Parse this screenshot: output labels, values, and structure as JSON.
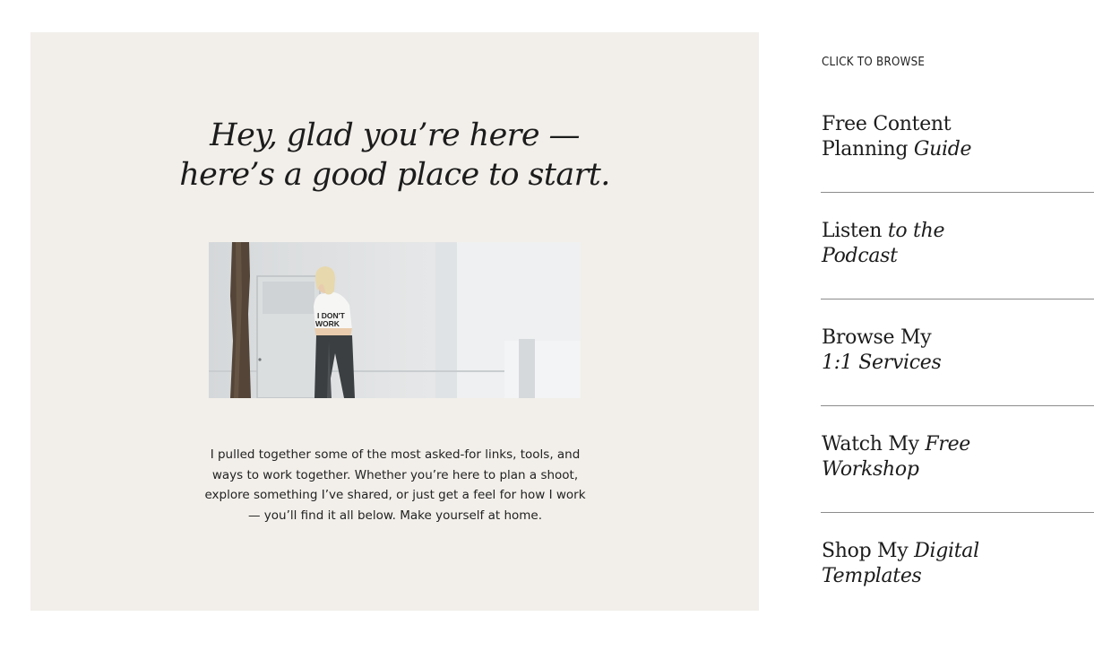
{
  "hero": {
    "title_line1": "Hey, glad you’re here —",
    "title_line2": "here’s a good place to start.",
    "photo_alt": "Woman in a white T-shirt leaning against a white wall beside a tree",
    "photo_shirt_text_line1": "I DON'T",
    "photo_shirt_text_line2": "WORK",
    "body": "I pulled together some of the most asked-for links, tools, and ways to work together. Whether you’re here to plan a shoot, explore something I’ve shared, or just get a feel for how I work — you’ll find it all below. Make yourself at home."
  },
  "browse": {
    "label": "CLICK TO BROWSE",
    "items": [
      {
        "line1_plain": "Free Content",
        "line1_italic": "",
        "line2_plain": "Planning ",
        "line2_italic": "Guide"
      },
      {
        "line1_plain": "Listen ",
        "line1_italic": "to the",
        "line2_plain": "",
        "line2_italic": "Podcast"
      },
      {
        "line1_plain": "Browse My",
        "line1_italic": "",
        "line2_plain": "",
        "line2_italic": "1:1 Services"
      },
      {
        "line1_plain": "Watch My ",
        "line1_italic": "Free",
        "line2_plain": "",
        "line2_italic": "Workshop"
      },
      {
        "line1_plain": "Shop My ",
        "line1_italic": "Digital",
        "line2_plain": "",
        "line2_italic": "Templates"
      }
    ]
  },
  "colors": {
    "panel_background": "#f2efea",
    "text": "#1c1c1c",
    "divider": "#8c8c8c"
  }
}
